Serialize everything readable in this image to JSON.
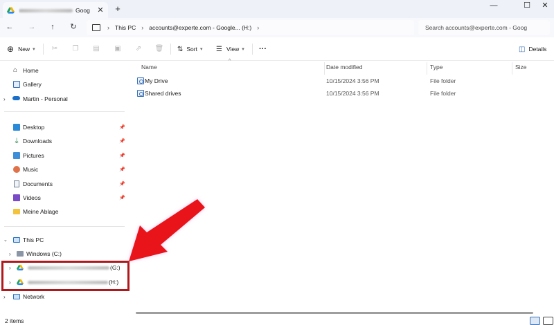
{
  "window": {
    "tab_title_tail": "Goog",
    "close_tab": "✕",
    "new_tab": "+",
    "minimize": "—",
    "maximize": "☐",
    "close": "✕"
  },
  "address": {
    "crumbs": [
      "This PC",
      "accounts@experte.com - Google... (H:)"
    ],
    "search_placeholder": "Search accounts@experte.com - Goog"
  },
  "toolbar": {
    "new_label": "New",
    "sort_label": "Sort",
    "view_label": "View",
    "more_label": "···",
    "details_label": "Details"
  },
  "sidebar": {
    "quick": [
      {
        "label": "Home",
        "icon": "home-icon"
      },
      {
        "label": "Gallery",
        "icon": "gallery-icon"
      },
      {
        "label": "Martin - Personal",
        "icon": "onedrive-icon"
      }
    ],
    "pinned": [
      {
        "label": "Desktop",
        "icon": "desktop-icon"
      },
      {
        "label": "Downloads",
        "icon": "downloads-icon"
      },
      {
        "label": "Pictures",
        "icon": "pictures-icon"
      },
      {
        "label": "Music",
        "icon": "music-icon"
      },
      {
        "label": "Documents",
        "icon": "documents-icon"
      },
      {
        "label": "Videos",
        "icon": "videos-icon"
      },
      {
        "label": "Meine Ablage",
        "icon": "folder-icon"
      }
    ],
    "this_pc": "This PC",
    "windows_drive": "Windows (C:)",
    "drive_g_suffix": "(G:)",
    "drive_h_suffix": "(H:)",
    "network": "Network"
  },
  "columns": {
    "name": "Name",
    "date": "Date modified",
    "type": "Type",
    "size": "Size"
  },
  "files": [
    {
      "name": "My Drive",
      "date": "10/15/2024 3:56 PM",
      "type": "File folder",
      "size": ""
    },
    {
      "name": "Shared drives",
      "date": "10/15/2024 3:56 PM",
      "type": "File folder",
      "size": ""
    }
  ],
  "status": {
    "items": "2 items"
  },
  "colors": {
    "accent": "#3a6fb7",
    "highlight_border": "#b0181c",
    "arrow": "#e8141a"
  }
}
